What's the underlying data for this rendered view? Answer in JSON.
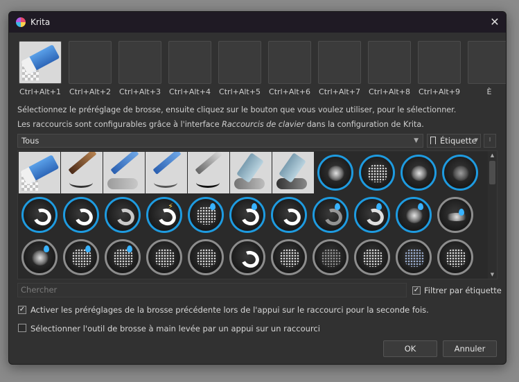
{
  "window": {
    "title": "Krita"
  },
  "slots": [
    {
      "key": "Ctrl+Alt+1",
      "filled": true
    },
    {
      "key": "Ctrl+Alt+2",
      "filled": false
    },
    {
      "key": "Ctrl+Alt+3",
      "filled": false
    },
    {
      "key": "Ctrl+Alt+4",
      "filled": false
    },
    {
      "key": "Ctrl+Alt+5",
      "filled": false
    },
    {
      "key": "Ctrl+Alt+6",
      "filled": false
    },
    {
      "key": "Ctrl+Alt+7",
      "filled": false
    },
    {
      "key": "Ctrl+Alt+8",
      "filled": false
    },
    {
      "key": "Ctrl+Alt+9",
      "filled": false
    },
    {
      "key": "È",
      "filled": false
    }
  ],
  "info": {
    "line1": "Sélectionnez le préréglage de brosse, ensuite cliquez sur le bouton que vous voulez utiliser, pour le sélectionner.",
    "line2_prefix": "Les raccourcis sont configurables grâce à l'interface ",
    "line2_em": "Raccourcis de clavier",
    "line2_suffix": " dans la configuration de Krita."
  },
  "tagbar": {
    "selected": "Tous",
    "tag_button": "Étiquette"
  },
  "search": {
    "placeholder": "Chercher"
  },
  "filter": {
    "label": "Filtrer par étiquette",
    "checked": true
  },
  "options": {
    "opt1": {
      "label": "Activer les préréglages de la brosse précédente lors de l'appui sur le raccourci pour la seconde fois.",
      "checked": true
    },
    "opt2": {
      "label": "Sélectionner l'outil de brosse à main levée par un appui sur un raccourci",
      "checked": false
    }
  },
  "buttons": {
    "ok": "OK",
    "cancel": "Annuler"
  },
  "colors": {
    "blue_ring": "#1e9be0",
    "grey_ring": "#8d8d8d",
    "purple_ring": "#6f3fc8",
    "drop": "#39b3ff"
  }
}
